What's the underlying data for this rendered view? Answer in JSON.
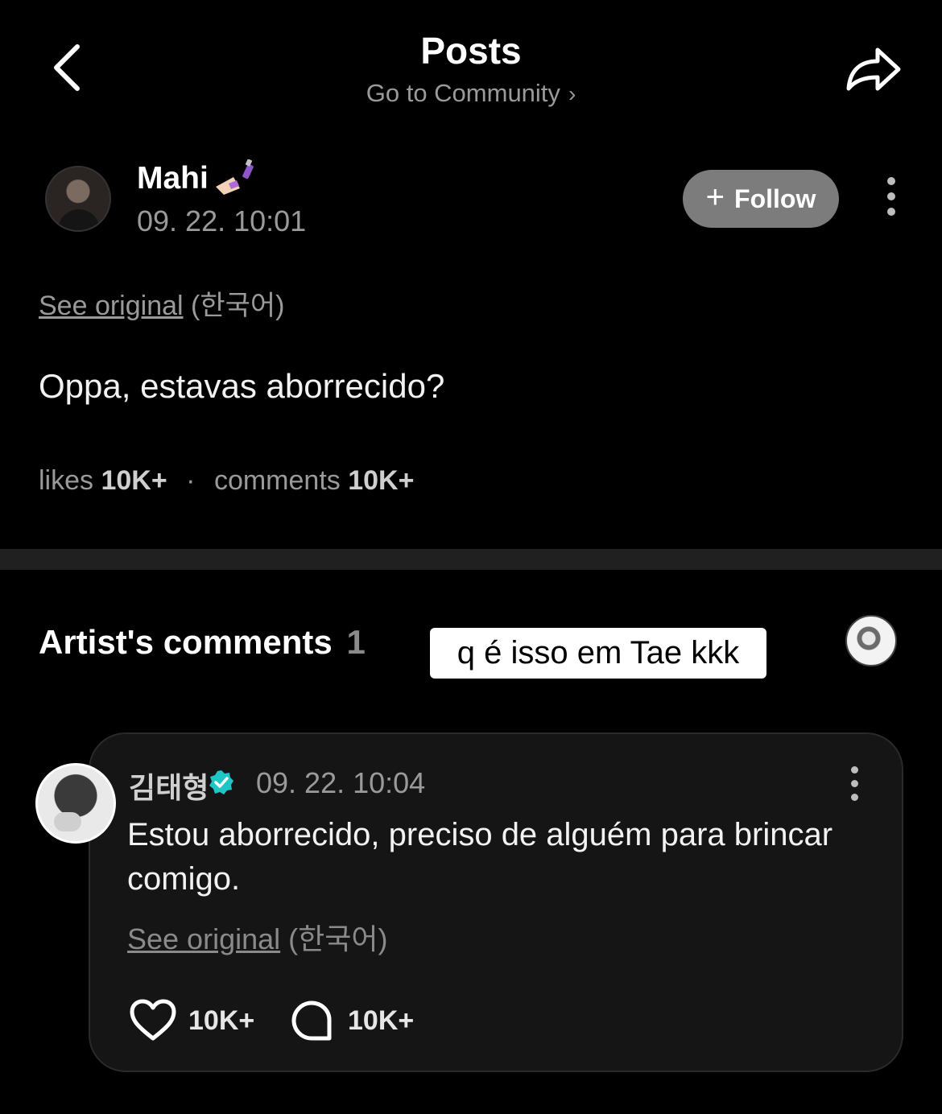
{
  "header": {
    "title": "Posts",
    "community_link": "Go to Community",
    "back_icon": "chevron-left-icon",
    "share_icon": "share-arrow-icon"
  },
  "post": {
    "author": "Mahi",
    "author_emoji": "nail-polish-emoji",
    "timestamp": "09. 22. 10:01",
    "follow_label": "Follow",
    "see_original_label": "See original",
    "original_language": "(한국어)",
    "body": "Oppa, estavas aborrecido?",
    "likes_label": "likes",
    "likes_count": "10K+",
    "comments_label": "comments",
    "comments_count": "10K+",
    "separator": "·"
  },
  "artist_comments": {
    "heading": "Artist's comments",
    "count": "1",
    "overlay_caption": "q é isso em Tae kkk",
    "comment": {
      "author": "김태형",
      "verified": true,
      "timestamp": "09. 22. 10:04",
      "body": "Estou aborrecido, preciso de alguém para brincar comigo.",
      "see_original_label": "See original",
      "original_language": "(한국어)",
      "like_count": "10K+",
      "reply_count": "10K+"
    }
  },
  "colors": {
    "background": "#000000",
    "card": "#151515",
    "follow_button": "#7c7c7c",
    "muted_text": "#9a9a9a",
    "verified_badge": "#1ec6c6"
  }
}
